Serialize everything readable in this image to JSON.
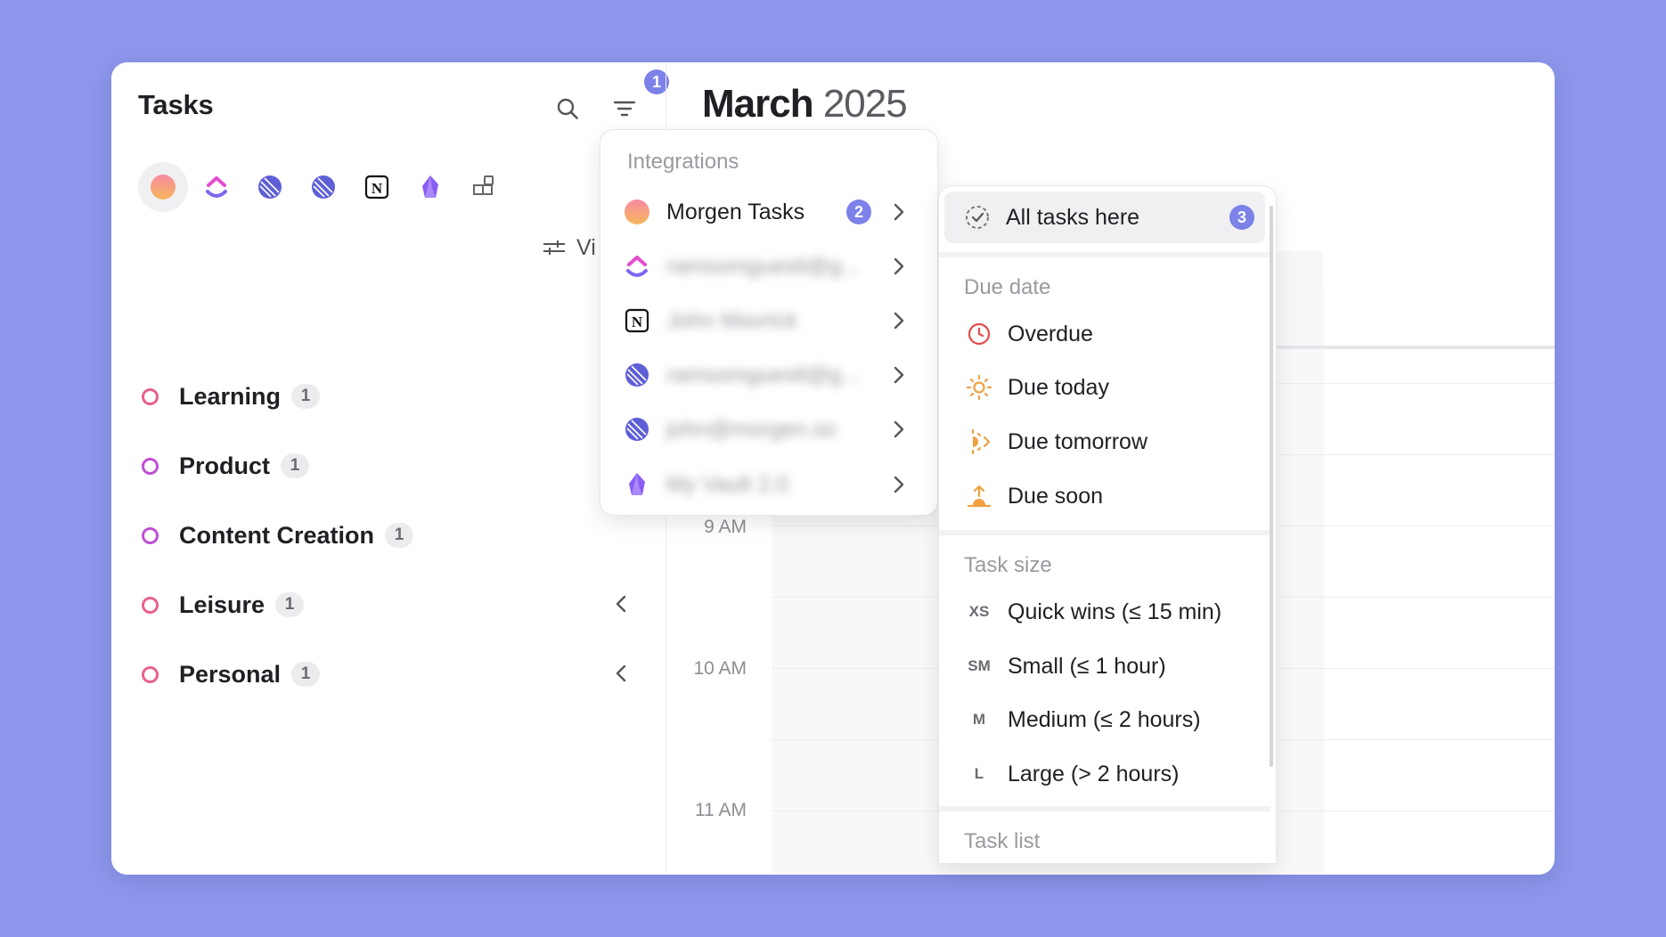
{
  "sidebar": {
    "title": "Tasks",
    "filter_badge": "1",
    "view_label": "Vi",
    "lists": [
      {
        "label": "Learning",
        "count": "1",
        "color": "#e8618c"
      },
      {
        "label": "Product",
        "count": "1",
        "color": "#c04fd6"
      },
      {
        "label": "Content Creation",
        "count": "1",
        "color": "#c04fd6"
      },
      {
        "label": "Leisure",
        "count": "1",
        "color": "#e8618c"
      },
      {
        "label": "Personal",
        "count": "1",
        "color": "#e8618c"
      }
    ]
  },
  "calendar": {
    "month": "March",
    "year": "2025",
    "times": [
      "9 AM",
      "10 AM",
      "11 AM"
    ]
  },
  "integrations_menu": {
    "heading": "Integrations",
    "items": [
      {
        "label": "Morgen Tasks",
        "badge": "2",
        "icon": "morgen-icon"
      },
      {
        "label": "ramsomguestl@g...",
        "icon": "clickup-icon"
      },
      {
        "label": "John Mavrick",
        "icon": "notion-icon"
      },
      {
        "label": "ramsomguestl@g...",
        "icon": "linear-icon"
      },
      {
        "label": "john@morgen.so",
        "icon": "linear-icon"
      },
      {
        "label": "My Vault 2.0",
        "icon": "obsidian-icon"
      }
    ]
  },
  "filter_menu": {
    "all_tasks": {
      "label": "All tasks here",
      "badge": "3"
    },
    "due_heading": "Due date",
    "due_items": [
      {
        "label": "Overdue",
        "icon": "clock-icon"
      },
      {
        "label": "Due today",
        "icon": "sun-icon"
      },
      {
        "label": "Due tomorrow",
        "icon": "sunrise-arrow-icon"
      },
      {
        "label": "Due soon",
        "icon": "sunrise-icon"
      }
    ],
    "size_heading": "Task size",
    "size_items": [
      {
        "tag": "XS",
        "label": "Quick wins (≤ 15 min)"
      },
      {
        "tag": "SM",
        "label": "Small (≤ 1 hour)"
      },
      {
        "tag": "M",
        "label": "Medium (≤ 2 hours)"
      },
      {
        "tag": "L",
        "label": "Large (> 2 hours)"
      }
    ],
    "list_heading": "Task list"
  },
  "colors": {
    "background": "#8c96ea",
    "accent": "#7c82e8",
    "overdue": "#e24b4b",
    "due_orange": "#f0a040"
  }
}
